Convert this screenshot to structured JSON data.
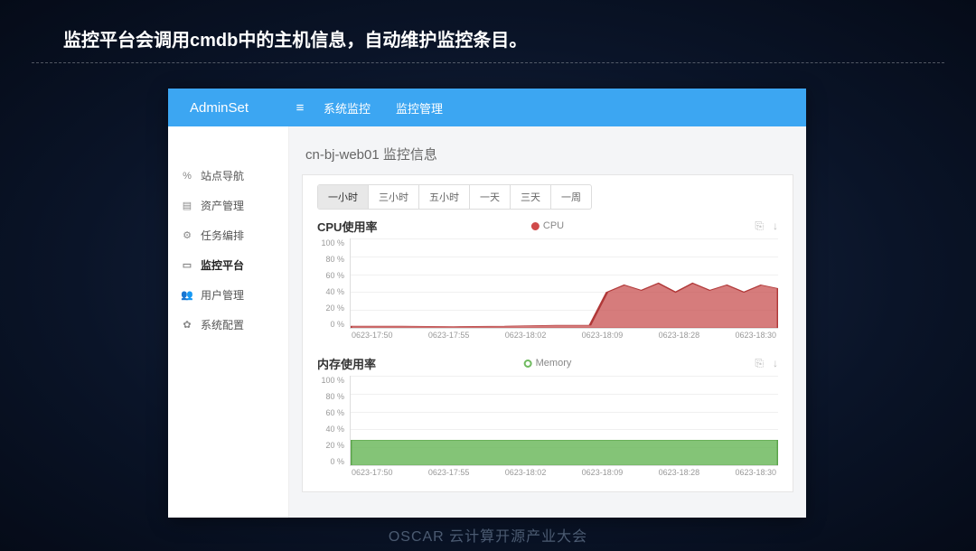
{
  "slide": {
    "title": "监控平台会调用cmdb中的主机信息，自动维护监控条目。"
  },
  "footer": {
    "brand": "OSCAR 云计算开源产业大会"
  },
  "app": {
    "brand": "AdminSet",
    "header_toggle_icon": "≡",
    "header_tabs": [
      "系统监控",
      "监控管理"
    ]
  },
  "sidebar": {
    "items": [
      {
        "icon": "link",
        "label": "站点导航"
      },
      {
        "icon": "list",
        "label": "资产管理"
      },
      {
        "icon": "tasks",
        "label": "任务编排"
      },
      {
        "icon": "monitor",
        "label": "监控平台",
        "active": true
      },
      {
        "icon": "users",
        "label": "用户管理"
      },
      {
        "icon": "gear",
        "label": "系统配置"
      }
    ]
  },
  "panel": {
    "title": "cn-bj-web01 监控信息",
    "time_tabs": [
      "一小时",
      "三小时",
      "五小时",
      "一天",
      "三天",
      "一周"
    ],
    "time_tab_active_index": 0
  },
  "chart_data": [
    {
      "type": "area",
      "title": "CPU使用率",
      "legend": "CPU",
      "color": "#c85050",
      "ylabel": "%",
      "ylim": [
        0,
        100
      ],
      "y_ticks": [
        "100 %",
        "80 %",
        "60 %",
        "40 %",
        "20 %",
        "0 %"
      ],
      "categories": [
        "0623-17:50",
        "0623-17:55",
        "0623-18:02",
        "0623-18:09",
        "0623-18:28",
        "0623-18:30"
      ],
      "values": [
        2,
        2,
        2,
        3,
        48,
        45
      ]
    },
    {
      "type": "area",
      "title": "内存使用率",
      "legend": "Memory",
      "color": "#6fba5f",
      "ylabel": "%",
      "ylim": [
        0,
        100
      ],
      "y_ticks": [
        "100 %",
        "80 %",
        "60 %",
        "40 %",
        "20 %",
        "0 %"
      ],
      "categories": [
        "0623-17:50",
        "0623-17:55",
        "0623-18:02",
        "0623-18:09",
        "0623-18:28",
        "0623-18:30"
      ],
      "values": [
        28,
        28,
        28,
        28,
        28,
        28
      ]
    }
  ],
  "icons": {
    "copy": "⎘",
    "download": "↓"
  }
}
